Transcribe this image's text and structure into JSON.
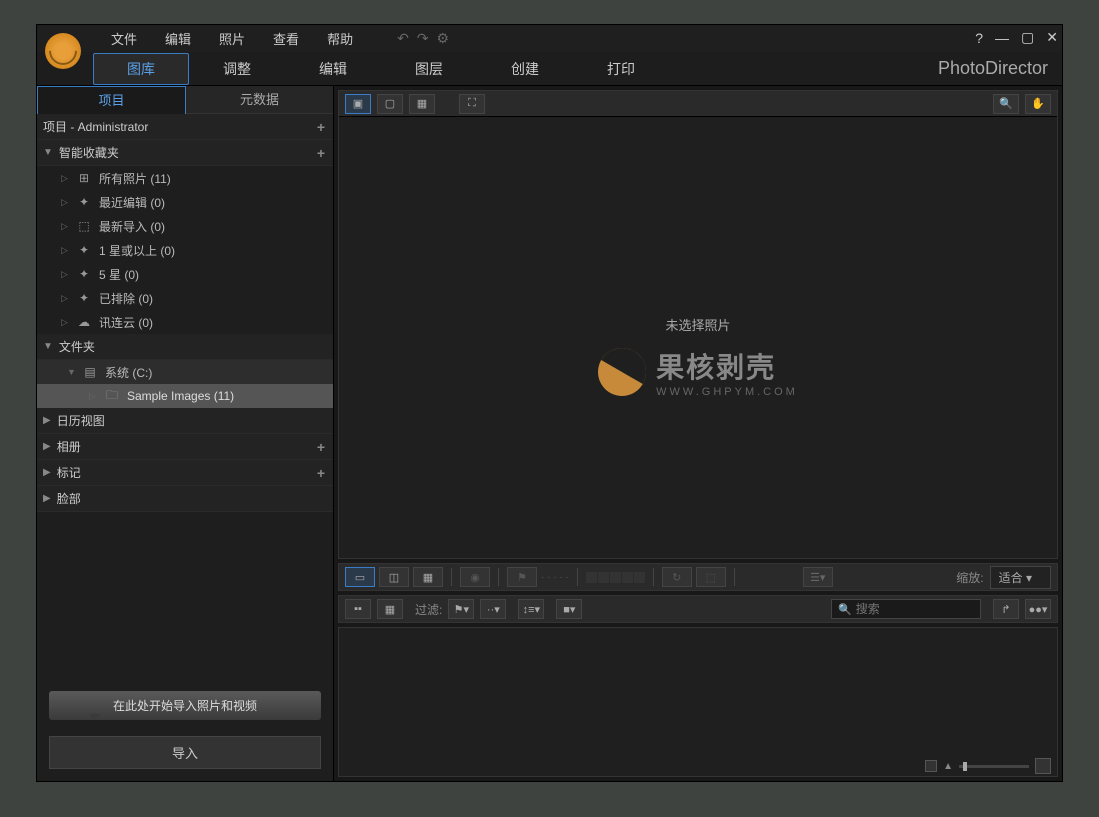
{
  "menu": {
    "file": "文件",
    "edit": "编辑",
    "photo": "照片",
    "view": "查看",
    "help": "帮助"
  },
  "modules": {
    "library": "图库",
    "adjust": "调整",
    "edit": "编辑",
    "layer": "图层",
    "create": "创建",
    "print": "打印"
  },
  "brand": "PhotoDirector",
  "sidebar_tabs": {
    "project": "项目",
    "metadata": "元数据"
  },
  "project_head": "项目 - Administrator",
  "sections": {
    "smart": "智能收藏夹",
    "folders": "文件夹",
    "calendar": "日历视图",
    "album": "相册",
    "tag": "标记",
    "face": "脸部"
  },
  "smart_items": {
    "all": "所有照片 (11)",
    "recent": "最近编辑 (0)",
    "latest": "最新导入 (0)",
    "star1": "1 星或以上 (0)",
    "star5": "5 星 (0)",
    "excluded": "已排除 (0)",
    "cloud": "讯连云 (0)"
  },
  "folder_items": {
    "system": "系统 (C:)",
    "sample": "Sample Images (11)"
  },
  "import_tip": "在此处开始导入照片和视频",
  "import_btn": "导入",
  "no_photo": "未选择照片",
  "watermark": {
    "main": "果核剥壳",
    "sub": "WWW.GHPYM.COM"
  },
  "filter_label": "过滤:",
  "zoom_label": "缩放:",
  "zoom_value": "适合",
  "search_placeholder": "搜索"
}
